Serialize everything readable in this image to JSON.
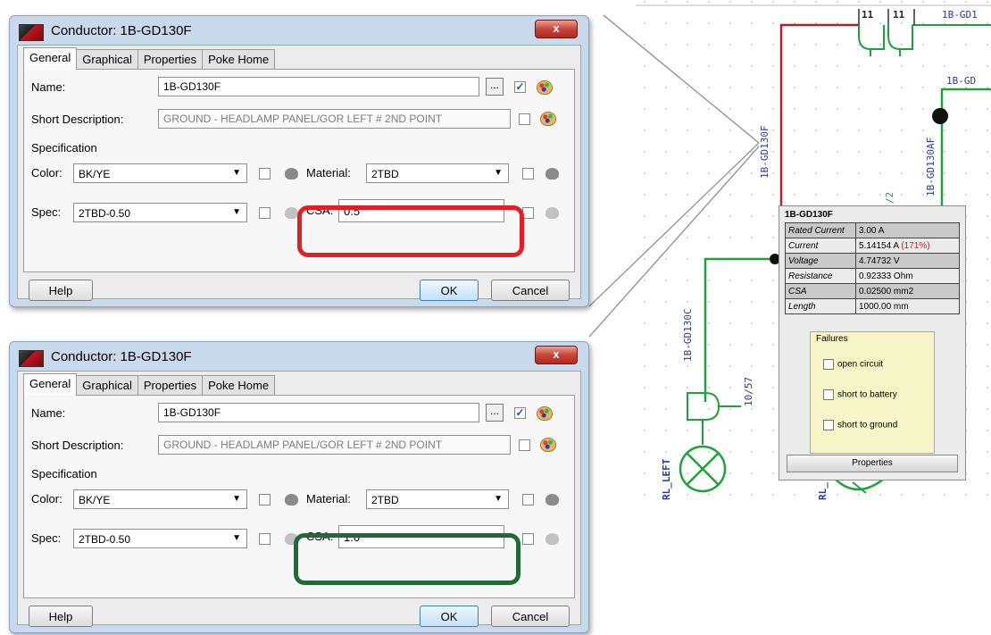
{
  "dialogs": [
    {
      "title": "Conductor: 1B-GD130F",
      "close_glyph": "x",
      "tabs": [
        "General",
        "Graphical",
        "Properties",
        "Poke Home"
      ],
      "name_label": "Name:",
      "name_value": "1B-GD130F",
      "dots_label": "...",
      "short_desc_label": "Short Description:",
      "short_desc_value": "GROUND - HEADLAMP PANEL/GOR LEFT # 2ND POINT",
      "spec_heading": "Specification",
      "color_label": "Color:",
      "color_value": "BK/YE",
      "material_label": "Material:",
      "material_value": "2TBD",
      "spec_label": "Spec:",
      "spec_value": "2TBD-0.50",
      "csa_label": "CSA:",
      "csa_value": "0.5",
      "help_label": "Help",
      "ok_label": "OK",
      "cancel_label": "Cancel",
      "highlight_color": "#e31e24"
    },
    {
      "title": "Conductor: 1B-GD130F",
      "close_glyph": "x",
      "tabs": [
        "General",
        "Graphical",
        "Properties",
        "Poke Home"
      ],
      "name_label": "Name:",
      "name_value": "1B-GD130F",
      "dots_label": "...",
      "short_desc_label": "Short Description:",
      "short_desc_value": "GROUND - HEADLAMP PANEL/GOR LEFT # 2ND POINT",
      "spec_heading": "Specification",
      "color_label": "Color:",
      "color_value": "BK/YE",
      "material_label": "Material:",
      "material_value": "2TBD",
      "spec_label": "Spec:",
      "spec_value": "2TBD-0.50",
      "csa_label": "CSA:",
      "csa_value": "1.0",
      "help_label": "Help",
      "ok_label": "OK",
      "cancel_label": "Cancel",
      "highlight_color": "#1f6b33"
    }
  ],
  "schematic": {
    "labels": {
      "top_left_11": "11",
      "top_right_11": "11",
      "top_wire": "1B-GD1",
      "right_wire": "1B-GD",
      "vertical_f": "1B-GD130F",
      "vertical_af": "1B-GD130AF",
      "vertical_c": "1B-GD130C",
      "connector": "10/57",
      "lamp_left": "RL_LEFT",
      "lamp_right": "RL_",
      "partial_2": "/2"
    },
    "colors": {
      "wire_red": "#b3202a",
      "wire_green": "#1ea33a",
      "label_blue": "#2a3a9a"
    }
  },
  "popup": {
    "title": "1B-GD130F",
    "rows": [
      {
        "key": "Rated Current",
        "value": "3.00 A"
      },
      {
        "key": "Current",
        "value": "5.14154 A",
        "extra": "(171%)"
      },
      {
        "key": "Voltage",
        "value": "4.74732 V"
      },
      {
        "key": "Resistance",
        "value": "0.92333 Ohm"
      },
      {
        "key": "CSA",
        "value": "0.02500 mm2"
      },
      {
        "key": "Length",
        "value": "1000.00 mm"
      }
    ],
    "failures_heading": "Failures",
    "failures": [
      "open circuit",
      "short to battery",
      "short to ground"
    ],
    "properties_label": "Properties"
  }
}
